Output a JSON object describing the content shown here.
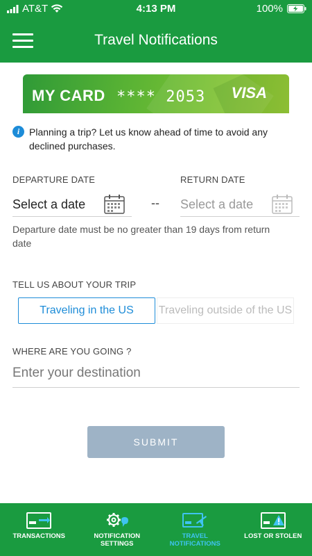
{
  "status_bar": {
    "carrier": "AT&T",
    "time": "4:13 PM",
    "battery": "100%"
  },
  "header": {
    "title": "Travel Notifications",
    "menu_icon": "hamburger-menu-icon"
  },
  "card": {
    "label": "MY CARD",
    "number": "**** 2053",
    "brand": "VISA"
  },
  "info": {
    "icon": "info-icon",
    "text": "Planning a trip? Let us know ahead of time to avoid any declined purchases."
  },
  "dates": {
    "departure_label": "DEPARTURE DATE",
    "departure_value": "Select a date",
    "separator": "--",
    "return_label": "RETURN DATE",
    "return_value": "Select a date",
    "hint": "Departure date must be no greater than 19 days from return date"
  },
  "trip": {
    "label": "TELL US ABOUT YOUR TRIP",
    "option_us": "Traveling in the US",
    "option_outside": "Traveling outside of the US",
    "selected": "Traveling in the US"
  },
  "destination": {
    "label": "WHERE ARE YOU GOING ?",
    "placeholder": "Enter your destination"
  },
  "submit_label": "SUBMIT",
  "tabs": [
    {
      "label": "TRANSACTIONS",
      "icon": "card-transactions-icon"
    },
    {
      "label": "NOTIFICATION SETTINGS",
      "icon": "gear-chat-icon"
    },
    {
      "label": "TRAVEL NOTIFICATIONS",
      "icon": "card-plane-icon",
      "active": true
    },
    {
      "label": "LOST OR STOLEN",
      "icon": "card-warning-icon"
    }
  ],
  "colors": {
    "brand_green": "#1a9b40",
    "accent_blue": "#1d8cd8",
    "active_tab": "#3fc3f0",
    "submit_disabled": "#9eb3c6"
  }
}
